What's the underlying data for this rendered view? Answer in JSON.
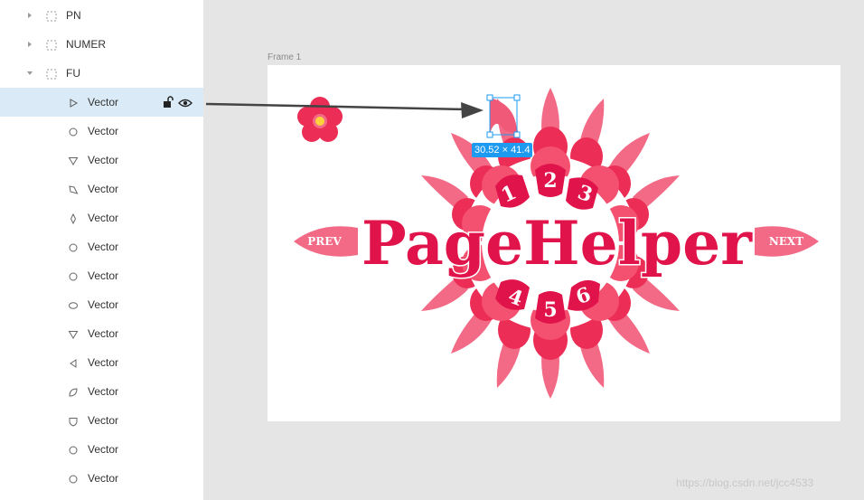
{
  "layers": {
    "groups": [
      {
        "label": "PN"
      },
      {
        "label": "NUMER"
      },
      {
        "label": "FU"
      }
    ],
    "vectors": [
      {
        "label": "Vector",
        "shape": "triangle-right",
        "selected": true
      },
      {
        "label": "Vector",
        "shape": "circle"
      },
      {
        "label": "Vector",
        "shape": "triangle-down"
      },
      {
        "label": "Vector",
        "shape": "quad"
      },
      {
        "label": "Vector",
        "shape": "diamond"
      },
      {
        "label": "Vector",
        "shape": "circle"
      },
      {
        "label": "Vector",
        "shape": "circle"
      },
      {
        "label": "Vector",
        "shape": "oval"
      },
      {
        "label": "Vector",
        "shape": "triangle-down"
      },
      {
        "label": "Vector",
        "shape": "triangle-left"
      },
      {
        "label": "Vector",
        "shape": "leaf"
      },
      {
        "label": "Vector",
        "shape": "shield"
      },
      {
        "label": "Vector",
        "shape": "circle"
      },
      {
        "label": "Vector",
        "shape": "circle"
      }
    ]
  },
  "canvas": {
    "frame_label": "Frame 1",
    "selection_size": "30.52 × 41.4",
    "artwork": {
      "title": "PageHelper",
      "prev": "PREV",
      "next": "NEXT",
      "numbers": [
        "1",
        "2",
        "3",
        "4",
        "5",
        "6"
      ]
    },
    "watermark": "https://blog.csdn.net/jcc4533"
  },
  "colors": {
    "accent": "#1e9bf0",
    "selection_bg": "#daebf7",
    "petal_dark": "#ec2d55",
    "petal_light": "#f26a86",
    "title": "#e0134a"
  }
}
